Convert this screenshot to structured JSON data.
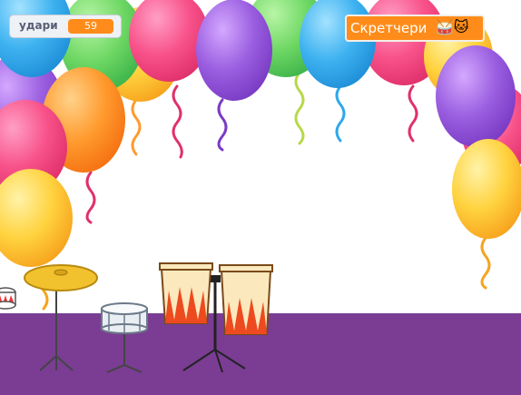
{
  "monitor": {
    "label": "удари",
    "value": "59"
  },
  "sprite_button": {
    "label": "Скретчери",
    "icons": "🥁🐱"
  },
  "colors": {
    "monitor_value": "#ff8c1a",
    "floor": "#7a3d93",
    "balloon_red": "#f2457e",
    "balloon_orange": "#ff8a1f",
    "balloon_yellow": "#ffc933",
    "balloon_green": "#5fd062",
    "balloon_blue": "#2fa8ea",
    "balloon_purple": "#8f4fd3"
  }
}
